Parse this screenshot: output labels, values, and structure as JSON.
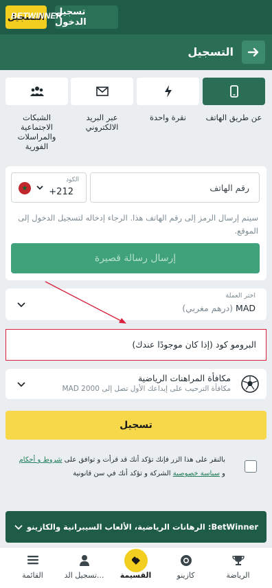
{
  "header": {
    "logo": "BETWINNER",
    "login_label": "تسجيل الدخول",
    "register_label": "التسجيل"
  },
  "titlebar": {
    "title": "التسجيل"
  },
  "methods": [
    {
      "label": "عن طريق الهاتف",
      "icon": "phone-icon",
      "active": true
    },
    {
      "label": "نقرة واحدة",
      "icon": "lightning-icon",
      "active": false
    },
    {
      "label": "عبر البريد الالكتروني",
      "icon": "envelope-icon",
      "active": false
    },
    {
      "label": "الشبكات الاجتماعية والمراسلات الفورية",
      "icon": "users-icon",
      "active": false
    }
  ],
  "phone_form": {
    "country_label": "الكود",
    "country_code": "+212",
    "phone_placeholder": "رقم الهاتف",
    "note": "سيتم إرسال الرمز إلى رقم الهاتف هذا. الرجاء إدخاله لتسجيل الدخول إلى الموقع.",
    "send_sms_label": "إرسال رسالة قصيرة"
  },
  "currency": {
    "label": "اختر العملة",
    "code": "MAD",
    "name": "(درهم مغربي)"
  },
  "promo": {
    "placeholder": "البرومو كود (إذا كان موجودًا عندك)"
  },
  "bonus": {
    "title": "مكافأة المراهنات الرياضية",
    "subtitle": "مكافأة الترحيب على إيداعك الأول تصل إلى 2000 MAD"
  },
  "register_button": "تسجيل",
  "consent": {
    "prefix": "بالنقر على هذا الزر فإنك تؤكد أنك قد قرأت و توافق على",
    "terms_link": "شروط و أحكام",
    "and": "و",
    "privacy_link": "سياسة خصوصية",
    "suffix": "الشركة و تؤكد أنك في سن قانونية"
  },
  "seo_bar": {
    "text": "BetWinner: الرهانات الرياضية، الألعاب السيبرانية والكازينو"
  },
  "bottom_nav": [
    {
      "label": "الرياضة",
      "icon": "trophy-icon"
    },
    {
      "label": "كازينو",
      "icon": "casino-chip-icon"
    },
    {
      "label": "القسيمة",
      "icon": "ticket-icon"
    },
    {
      "label": "تسجيل الد...",
      "icon": "user-icon"
    },
    {
      "label": "القائمة",
      "icon": "menu-icon"
    }
  ],
  "colors": {
    "brand_dark": "#1e5c47",
    "brand": "#2a6e55",
    "accent_yellow": "#f2ce21",
    "sms_green": "#3fa27a",
    "highlight_red": "#d91f3c"
  }
}
